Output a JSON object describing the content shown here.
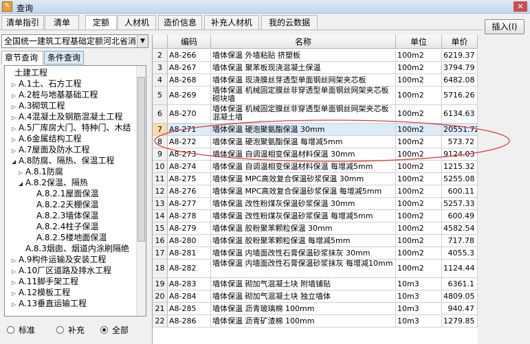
{
  "window": {
    "title": "查询",
    "close": "✕"
  },
  "tabs": [
    "清单指引",
    "清单",
    "定额",
    "人材机",
    "造价信息",
    "补充人材机",
    "我的云数据"
  ],
  "active_tab": "定额",
  "insert_button": "插入(I)",
  "left": {
    "dropdown": "全国统一建筑工程基础定额河北省消",
    "subtabs": [
      "章节查询",
      "条件查询"
    ],
    "tree": [
      {
        "label": "土建工程",
        "level": 0,
        "exp": ""
      },
      {
        "label": "A.1土、石方工程",
        "level": 1,
        "exp": "▷"
      },
      {
        "label": "A.2桩与地基基础工程",
        "level": 1,
        "exp": "▷"
      },
      {
        "label": "A.3砌筑工程",
        "level": 1,
        "exp": "▷"
      },
      {
        "label": "A.4混凝土及钢筋混凝土工程",
        "level": 1,
        "exp": "▷"
      },
      {
        "label": "A.5厂库房大门、特种门、木结",
        "level": 1,
        "exp": "▷"
      },
      {
        "label": "A.6金属结构工程",
        "level": 1,
        "exp": "▷"
      },
      {
        "label": "A.7屋面及防水工程",
        "level": 1,
        "exp": "▷"
      },
      {
        "label": "A.8防腐、隔热、保温工程",
        "level": 1,
        "exp": "◢"
      },
      {
        "label": "A.8.1防腐",
        "level": 2,
        "exp": "▷"
      },
      {
        "label": "A.8.2保温、隔热",
        "level": 2,
        "exp": "◢"
      },
      {
        "label": "A.8.2.1屋面保温",
        "level": 3,
        "exp": ""
      },
      {
        "label": "A.8.2.2天棚保温",
        "level": 3,
        "exp": ""
      },
      {
        "label": "A.8.2.3墙体保温",
        "level": 3,
        "exp": ""
      },
      {
        "label": "A.8.2.4柱子保温",
        "level": 3,
        "exp": ""
      },
      {
        "label": "A.8.2.5楼地面保温",
        "level": 3,
        "exp": ""
      },
      {
        "label": "A.8.3烟囱、烟道内涂刷隔绝",
        "level": 2,
        "exp": ""
      },
      {
        "label": "A.9构件运输及安装工程",
        "level": 1,
        "exp": "▷"
      },
      {
        "label": "A.10厂区道路及排水工程",
        "level": 1,
        "exp": "▷"
      },
      {
        "label": "A.11脚手架工程",
        "level": 1,
        "exp": "▷"
      },
      {
        "label": "A.12模板工程",
        "level": 1,
        "exp": "▷"
      },
      {
        "label": "A.13垂直运输工程",
        "level": 1,
        "exp": "▷"
      }
    ],
    "radios": [
      "标准",
      "补充",
      "全部"
    ],
    "radio_selected": "全部"
  },
  "grid": {
    "headers": [
      "",
      "编码",
      "名称",
      "单位",
      "单价"
    ],
    "rows": [
      {
        "n": "2",
        "code": "A8-266",
        "name": "墙体保温 外墙粘贴 挤塑板",
        "unit": "100m2",
        "price": "6219.37"
      },
      {
        "n": "3",
        "code": "A8-267",
        "name": "墙体保温 聚苯板现浇混凝土保温",
        "unit": "100m2",
        "price": "3794.79"
      },
      {
        "n": "4",
        "code": "A8-268",
        "name": "墙体保温 现浇膜丝芽透型单面钢丝网架夹芯板",
        "unit": "100m2",
        "price": "6482.08"
      },
      {
        "n": "5",
        "code": "A8-269",
        "name": "墙体保温 机械固定膜丝非穿透型单面钢丝网架夹芯板 砌块墙",
        "unit": "100m2",
        "price": "5716.26"
      },
      {
        "n": "6",
        "code": "A8-270",
        "name": "墙体保温 机械固定膜丝非穿透型单面钢丝网架夹芯板 混凝土墙",
        "unit": "100m2",
        "price": "6134.63"
      },
      {
        "n": "7",
        "code": "A8-271",
        "name": "墙体保温 硬泡聚氨酯保温 30mm",
        "unit": "100m2",
        "price": "20551.72"
      },
      {
        "n": "8",
        "code": "A8-272",
        "name": "墙体保温 硬泡聚氨酯保温 每增减5mm",
        "unit": "100m2",
        "price": "573.72"
      },
      {
        "n": "9",
        "code": "A8-273",
        "name": "墙体保温 自调温相变保温材料保温 30mm",
        "unit": "100m2",
        "price": "9124.03"
      },
      {
        "n": "10",
        "code": "A8-274",
        "name": "墙体保温 自调温相变保温材料保温 每增减5mm",
        "unit": "100m2",
        "price": "1215.32"
      },
      {
        "n": "11",
        "code": "A8-275",
        "name": "墙体保温 MPC高效复合保温砂浆保温 30mm",
        "unit": "100m2",
        "price": "5255.08"
      },
      {
        "n": "12",
        "code": "A8-276",
        "name": "墙体保温 MPC高效复合保温砂浆保温 每增减5mm",
        "unit": "100m2",
        "price": "600.11"
      },
      {
        "n": "13",
        "code": "A8-277",
        "name": "墙体保温 改性粉煤灰保温砂浆保温 30mm",
        "unit": "100m2",
        "price": "5257.33"
      },
      {
        "n": "14",
        "code": "A8-278",
        "name": "墙体保温 改性粉煤灰保温砂浆保温 每增减5mm",
        "unit": "100m2",
        "price": "600.49"
      },
      {
        "n": "15",
        "code": "A8-279",
        "name": "墙体保温 胶粉聚苯颗粒保温 30mm",
        "unit": "100m2",
        "price": "4582.54"
      },
      {
        "n": "16",
        "code": "A8-280",
        "name": "墙体保温 胶粉聚苯颗粒保温 每增减5mm",
        "unit": "100m2",
        "price": "717.78"
      },
      {
        "n": "17",
        "code": "A8-281",
        "name": "墙体保温 内墙面改性石膏保温砂浆抹灰 30mm",
        "unit": "100m2",
        "price": "4055.3"
      },
      {
        "n": "18",
        "code": "A8-282",
        "name": "墙体保温 内墙面改性石膏保温砂浆抹灰 每增减10mm",
        "unit": "100m2",
        "price": "1124.44"
      },
      {
        "n": "19",
        "code": "A8-283",
        "name": "墙体保温 砌加气混凝土块 附墙铺贴",
        "unit": "10m3",
        "price": "6361.1"
      },
      {
        "n": "20",
        "code": "A8-284",
        "name": "墙体保温 砌加气混凝土块 独立墙体",
        "unit": "10m3",
        "price": "4809.05"
      },
      {
        "n": "21",
        "code": "A8-285",
        "name": "墙体保温 沥青玻璃棉 100mm",
        "unit": "10m3",
        "price": "940.47"
      },
      {
        "n": "22",
        "code": "A8-286",
        "name": "墙体保温 沥青矿渣棉 100mm",
        "unit": "10m3",
        "price": "1279.85"
      }
    ]
  }
}
